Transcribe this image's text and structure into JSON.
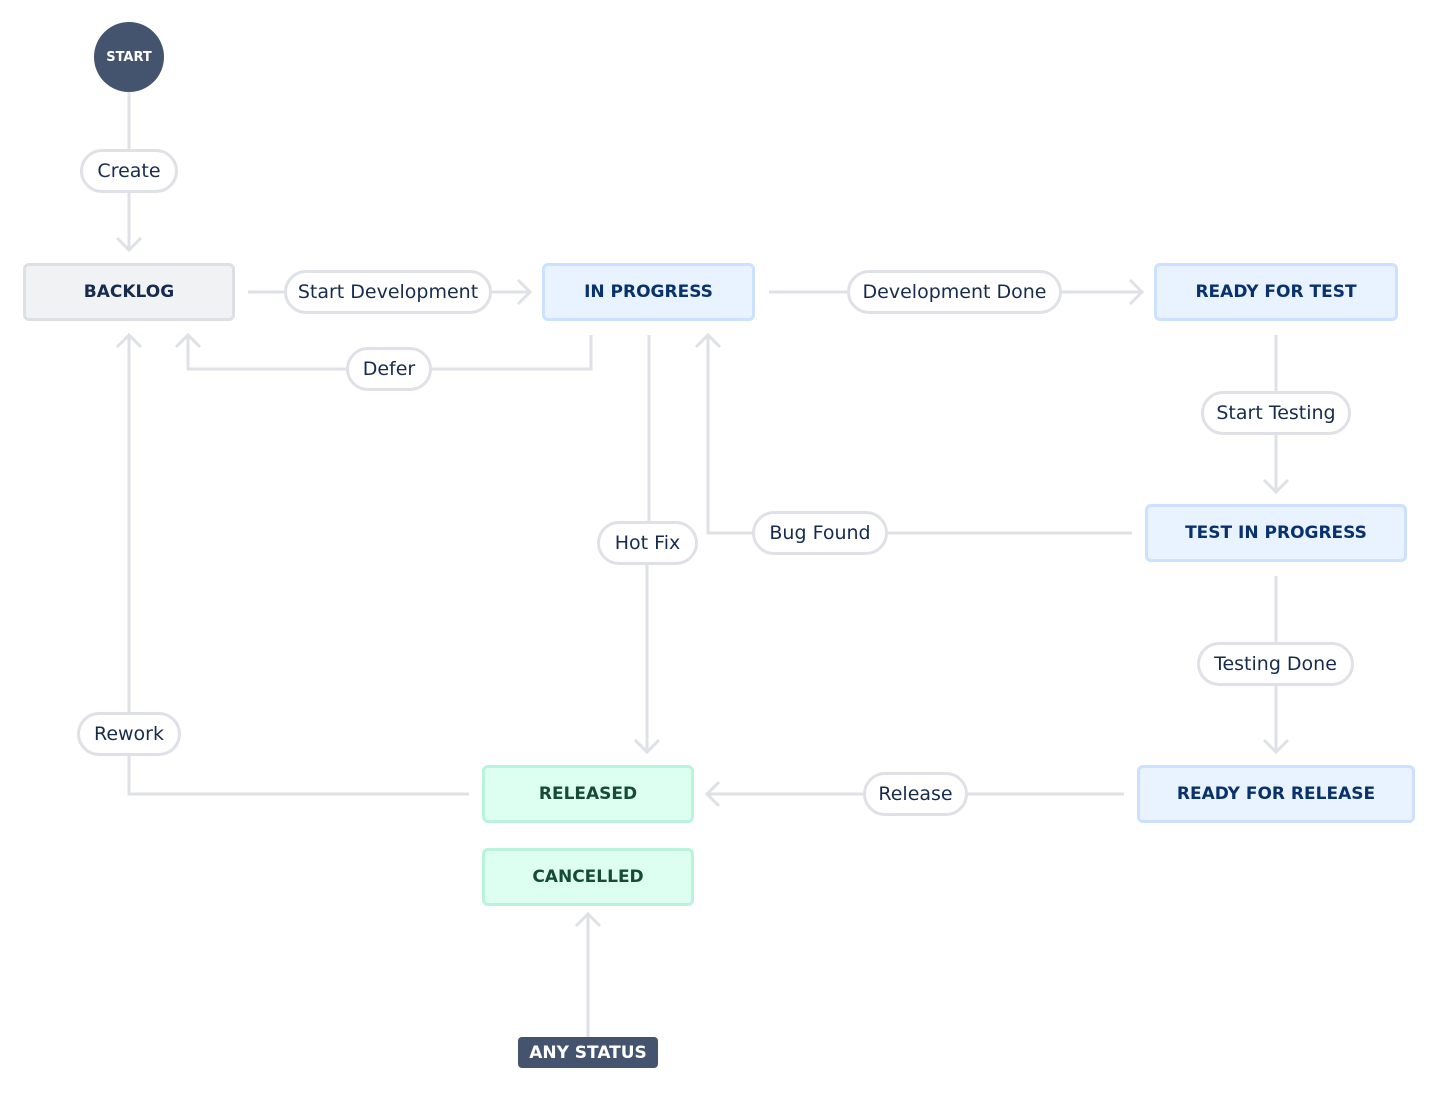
{
  "start": {
    "label": "START"
  },
  "any_status": {
    "label": "ANY STATUS"
  },
  "statuses": {
    "backlog": "BACKLOG",
    "in_progress": "IN PROGRESS",
    "ready_for_test": "READY FOR TEST",
    "test_in_progress": "TEST IN PROGRESS",
    "ready_for_release": "READY FOR RELEASE",
    "released": "RELEASED",
    "cancelled": "CANCELLED"
  },
  "transitions": {
    "create": "Create",
    "start_development": "Start Development",
    "defer": "Defer",
    "development_done": "Development Done",
    "start_testing": "Start Testing",
    "bug_found": "Bug Found",
    "hot_fix": "Hot Fix",
    "testing_done": "Testing Done",
    "release": "Release",
    "rework": "Rework"
  },
  "colors": {
    "start_node": "#44546f",
    "edge": "#dfe1e6",
    "todo_bg": "#f1f2f4",
    "in_progress_bg": "#e9f2ff",
    "done_bg": "#dcfff1"
  }
}
